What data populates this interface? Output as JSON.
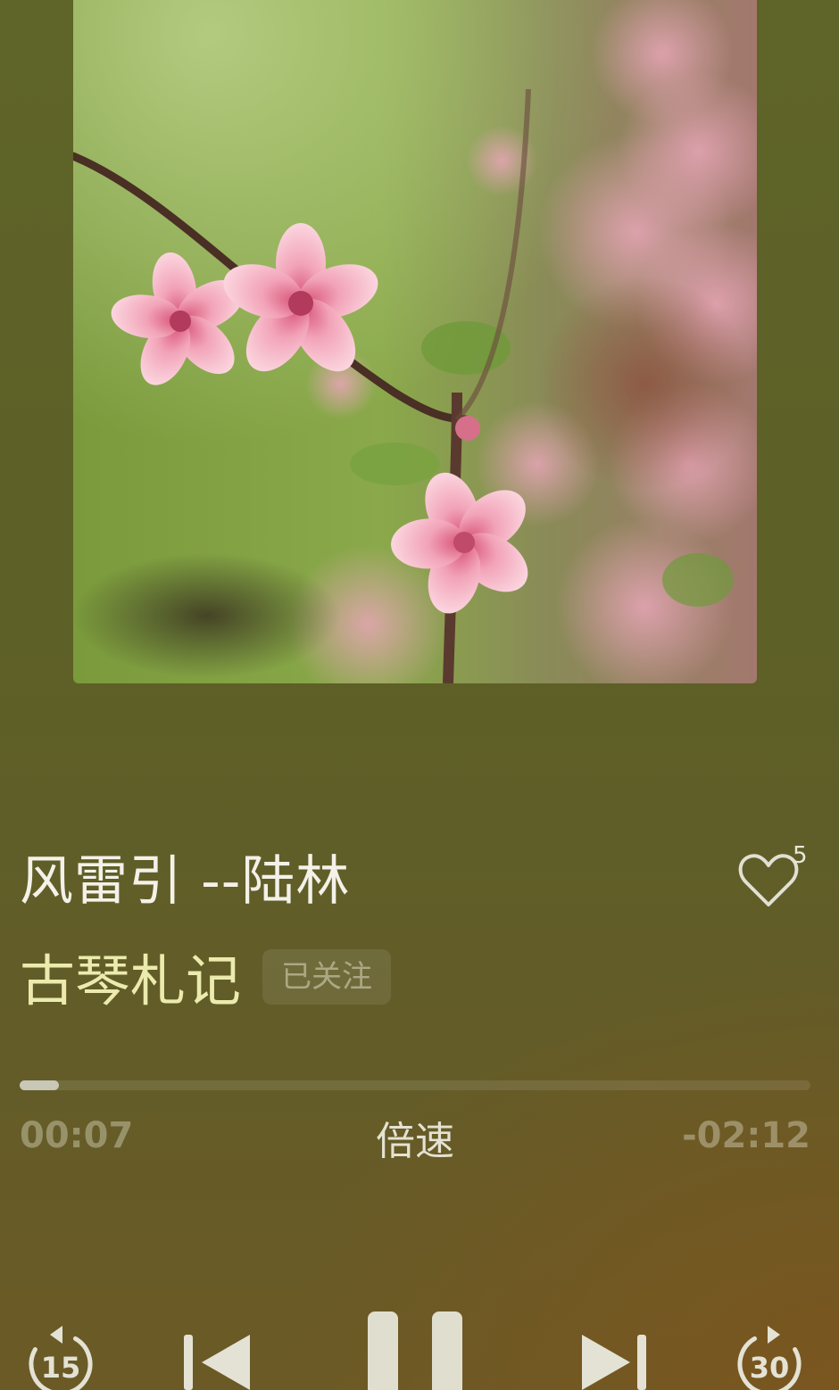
{
  "track": {
    "title": "风雷引 --陆林",
    "like_count": "5"
  },
  "channel": {
    "name": "古琴札记",
    "follow_label": "已关注"
  },
  "playback": {
    "elapsed": "00:07",
    "remaining": "-02:12",
    "speed_label": "倍速",
    "progress_fraction": 0.05,
    "state": "playing"
  },
  "controls": {
    "rewind_seconds": "15",
    "forward_seconds": "30",
    "icons": [
      "rewind-15-icon",
      "previous-icon",
      "pause-icon",
      "next-icon",
      "forward-30-icon"
    ]
  },
  "colors": {
    "background": "#5f6428",
    "channel_name": "#ecebae",
    "progress_fill": "#c9c7b8"
  }
}
